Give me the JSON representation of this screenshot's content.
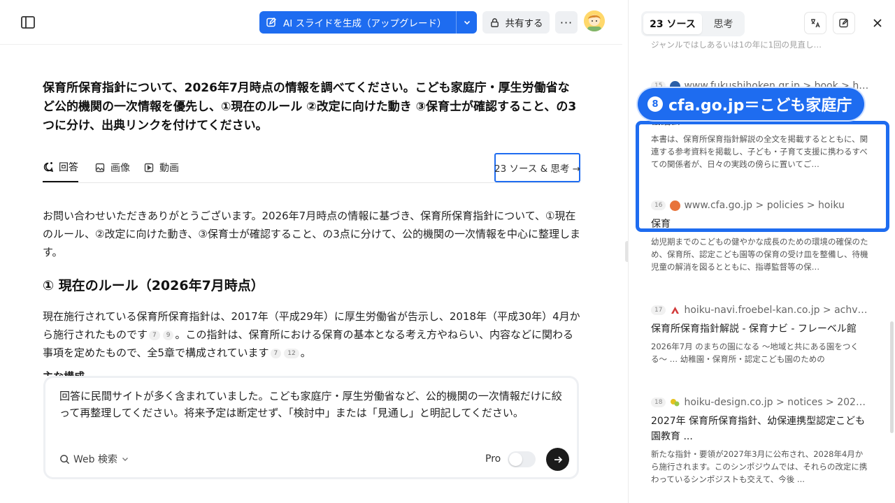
{
  "topbar": {
    "ai_button_label": "AI スライドを生成（アップグレード）",
    "share_label": "共有する",
    "more_label": "···"
  },
  "question": "保育所保育指針について、2026年7月時点の情報を調べてください。こども家庭庁・厚生労働省など公的機関の一次情報を優先し、①現在のルール ②改定に向けた動き ③保育士が確認すること、の3つに分け、出典リンクを付けてください。",
  "tabs": [
    {
      "label": "回答",
      "active": true
    },
    {
      "label": "画像",
      "active": false
    },
    {
      "label": "動画",
      "active": false
    }
  ],
  "sources_button_label": "23 ソース & 思考 →",
  "answer": {
    "intro": "お問い合わせいただきありがとうございます。2026年7月時点の情報に基づき、保育所保育指針について、①現在のルール、②改定に向けた動き、③保育士が確認すること、の3点に分けて、公的機関の一次情報を中心に整理します。",
    "heading1": "① 現在のルール（2026年7月時点）",
    "para1_a": "現在施行されている保育所保育指針は、2017年（平成29年）に厚生労働省が告示し、2018年（平成30年）4月から施行されたものです",
    "para1_cites_a": [
      "7",
      "9"
    ],
    "para1_b": "。この指針は、保育所における保育の基本となる考え方やねらい、内容などに関わる事項を定めたもので、全5章で構成されています",
    "para1_cites_b": [
      "7",
      "12"
    ],
    "para1_c": "。",
    "clipped_heading": "主な構成"
  },
  "composer": {
    "text": "回答に民間サイトが多く含まれていました。こども家庭庁・厚生労働省など、公的機関の一次情報だけに絞って再整理してください。将来予定は断定せず、「検討中」または「見通し」と明記してください。",
    "web_search_label": "Web 検索",
    "pro_label": "Pro"
  },
  "panel": {
    "tabs": [
      {
        "label": "23 ソース",
        "active": true
      },
      {
        "label": "思考",
        "active": false
      }
    ],
    "clipped_top_text": "ジャンルではしあるいは1の年に1回の見直し…",
    "sources": [
      {
        "num": "15",
        "url": "www.fukushihoken.gr.jp > book > h100…",
        "title": "協議会",
        "desc": "本書は、保育所保育指針解説の全文を掲載するとともに、関連する参考資料を掲載し、子ども・子育て支援に携わるすべての関係者が、日々の実践の傍らに置いてご…",
        "favicon_color": "#2b5fa8"
      },
      {
        "num": "16",
        "url": "www.cfa.go.jp > policies > hoiku",
        "title": "保育",
        "desc": "幼児期までのこどもの健やかな成長のための環境の確保のため、保育所、認定こども園等の保育の受け皿を整備し、待機児童の解消を図るとともに、指導監督等の保…",
        "favicon_color": "#e8733a"
      },
      {
        "num": "17",
        "url": "hoiku-navi.froebel-kan.co.jp > achv > h…",
        "title": "保育所保育指針解説 - 保育ナビ - フレーベル館",
        "desc": "2026年7月 のまちの園になる 〜地域と共にある園をつくる〜 … 幼稚園・保育所・認定こども園のための",
        "favicon_color": "#d23a3a"
      },
      {
        "num": "18",
        "url": "hoiku-design.co.jp > notices > 202606s…",
        "title": "2027年 保育所保育指針、幼保連携型認定こども園教育 ...",
        "desc": "新たな指針・要領が2027年3月に公布され、2028年4月から施行されます。このシンポジウムでは、それらの改定に携わっているシンポジストも交えて、今後 ...",
        "favicon_color": "#e5c21f"
      }
    ]
  },
  "callout": {
    "num": "8",
    "text": "cfa.go.jp＝こども家庭庁"
  },
  "colors": {
    "accent": "#1e6cf0",
    "send": "#1b1b1b"
  }
}
